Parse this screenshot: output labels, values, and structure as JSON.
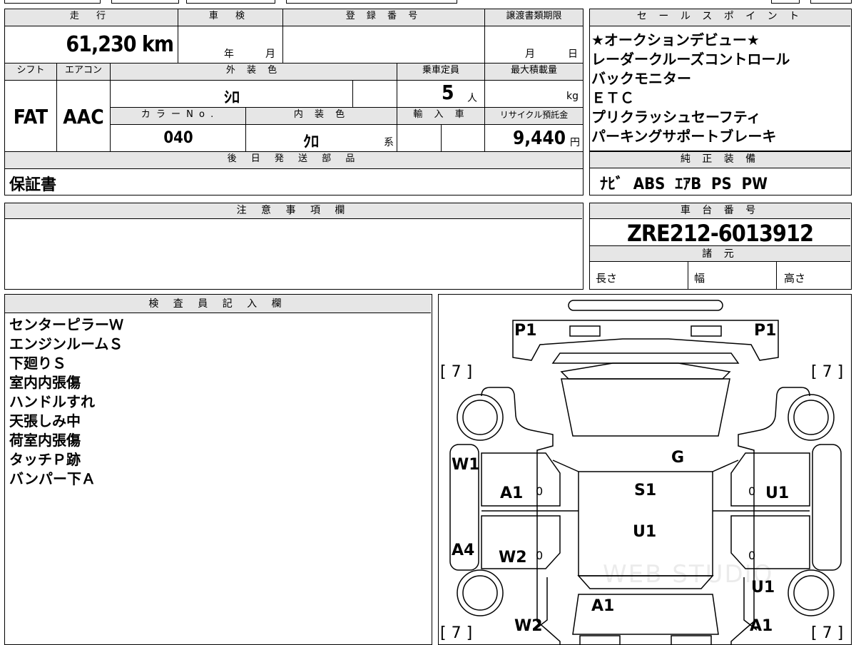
{
  "vehicle": {
    "mileage_label": "走 行",
    "mileage": "61,230 km",
    "inspection_label": "車 検",
    "inspection_year_unit": "年",
    "inspection_month_unit": "月",
    "registration_label": "登 録 番 号",
    "transfer_deadline_label": "譲渡書類期限",
    "transfer_month_unit": "月",
    "transfer_day_unit": "日",
    "shift_label": "シフト",
    "shift": "FAT",
    "aircon_label": "エアコン",
    "aircon": "AAC",
    "exterior_color_label": "外 装 色",
    "exterior_color": "ｼﾛ",
    "capacity_label": "乗車定員",
    "capacity": "5",
    "capacity_unit": "人",
    "max_load_label": "最大積載量",
    "max_load_unit": "kg",
    "color_no_label": "カ ラ ー N o .",
    "color_no": "040",
    "interior_color_label": "内 装 色",
    "interior_color": "ｸﾛ",
    "interior_suffix": "系",
    "import_label": "輸 入 車",
    "recycle_label": "リサイクル預託金",
    "recycle_fee": "9,440",
    "recycle_unit": "円",
    "later_parts_label": "後 日 発 送 部 品",
    "later_parts": "保証書"
  },
  "sales_points": {
    "label": "セ ー ル ス ポ イ ン ト",
    "items": [
      "★オークションデビュー★",
      "レーダークルーズコントロール",
      "バックモニター",
      "ＥＴＣ",
      "プリクラッシュセーフティ",
      "パーキングサポートブレーキ"
    ]
  },
  "genuine_equipment": {
    "label": "純 正 装 備",
    "value": "ﾅﾋﾞ  ABS  ｴｱB  PS  PW"
  },
  "notes": {
    "label": "注 意 事 項 欄",
    "value": ""
  },
  "chassis": {
    "label": "車 台 番 号",
    "value": "ZRE212-6013912",
    "specs_label": "諸 元",
    "length_label": "長さ",
    "width_label": "幅",
    "height_label": "高さ"
  },
  "inspector": {
    "label": "検 査 員 記 入 欄",
    "items": [
      "センターピラーＷ",
      "エンジンルームＳ",
      "下廻りＳ",
      "室内内張傷",
      "ハンドルすれ",
      "天張しみ中",
      "荷室内張傷",
      "タッチＰ跡",
      "バンパー下Ａ"
    ]
  },
  "diagram": {
    "marks": {
      "p1_left": "P1",
      "p1_right": "P1",
      "tire_fl": "[ 7 ]",
      "tire_fr": "[ 7 ]",
      "tire_rl": "[ 7 ]",
      "tire_rr": "[ 7 ]",
      "w1": "W1",
      "a4": "A4",
      "g": "G",
      "a1_left_front_door": "A1",
      "s1_roof": "S1",
      "u1_right_front_door": "U1",
      "u1_roof": "U1",
      "w2_left_rear_door": "W2",
      "u1_right_rear_fender": "U1",
      "a1_rear": "A1",
      "w2_left_rear_fender": "W2",
      "a1_right_rear": "A1",
      "zero1": "0",
      "zero2": "0",
      "zero3": "0",
      "zero4": "0"
    },
    "watermark": "WEB STUDIO"
  }
}
